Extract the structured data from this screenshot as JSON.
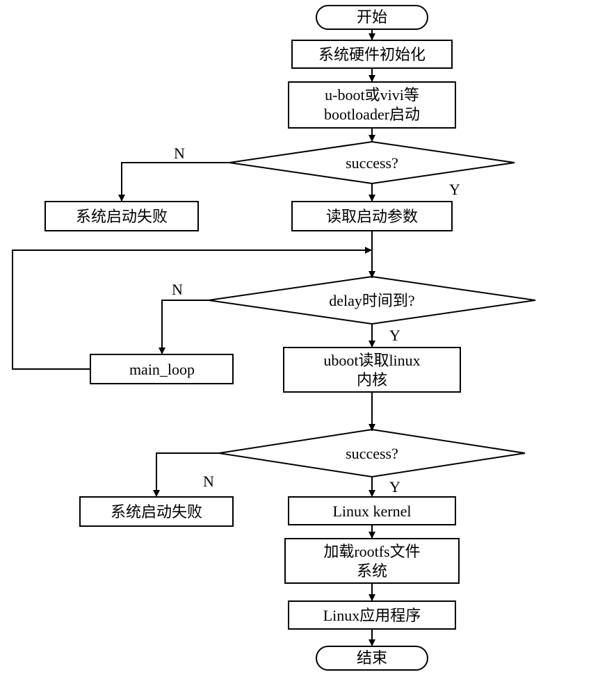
{
  "terminal_start": "开始",
  "terminal_end": "结束",
  "box_hwinit": "系统硬件初始化",
  "box_bootloader_l1": "u-boot或vivi等",
  "box_bootloader_l2": "bootloader启动",
  "dia_success1": "success?",
  "box_fail1": "系统启动失败",
  "box_readparam": "读取启动参数",
  "dia_delay": "delay时间到?",
  "box_mainloop": "main_loop",
  "box_uboot_l1": "uboot读取linux",
  "box_uboot_l2": "内核",
  "dia_success2": "success?",
  "box_fail2": "系统启动失败",
  "box_kernel": "Linux kernel",
  "box_rootfs_l1": "加载rootfs文件",
  "box_rootfs_l2": "系统",
  "box_app": "Linux应用程序",
  "label_N": "N",
  "label_Y": "Y"
}
